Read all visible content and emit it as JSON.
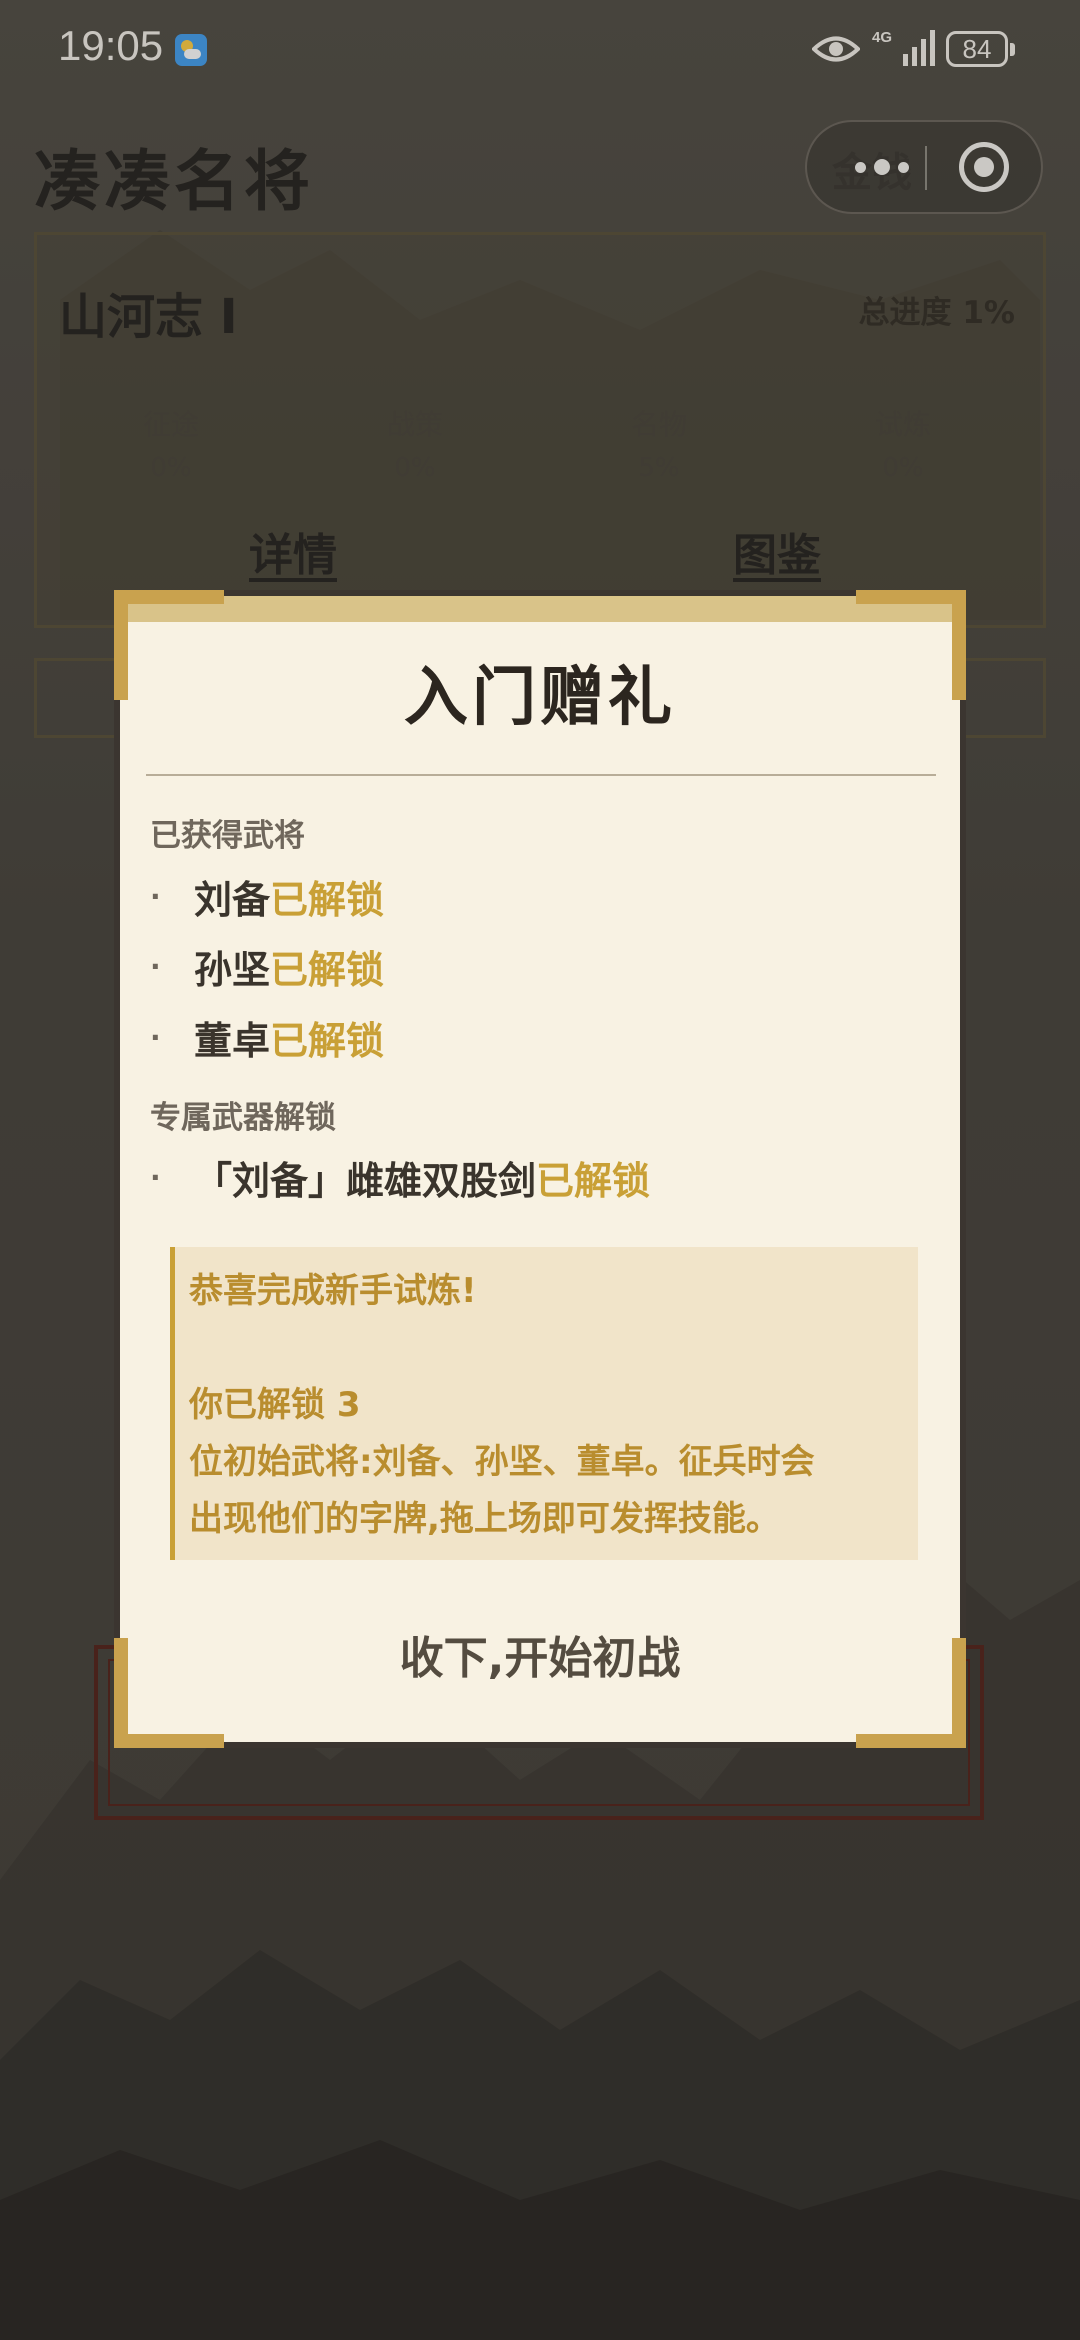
{
  "status_bar": {
    "time": "19:05",
    "network": "4G",
    "battery": "84"
  },
  "header": {
    "title": "凑凑名将",
    "currency_label": "金钱"
  },
  "progress_card": {
    "title": "山河志 I",
    "total_progress": "总进度 1%",
    "stats": [
      {
        "label": "征途",
        "value": "0%"
      },
      {
        "label": "战策",
        "value": "0%"
      },
      {
        "label": "名物",
        "value": "5%"
      },
      {
        "label": "试炼",
        "value": "0%"
      }
    ],
    "details_link": "详情",
    "codex_link": "图鉴"
  },
  "modal": {
    "title": "入门赠礼",
    "generals_section": "已获得武将",
    "generals": [
      {
        "name": "刘备",
        "status": "已解锁"
      },
      {
        "name": "孙坚",
        "status": "已解锁"
      },
      {
        "name": "董卓",
        "status": "已解锁"
      }
    ],
    "weapons_section": "专属武器解锁",
    "weapons": [
      {
        "name": "「刘备」雌雄双股剑",
        "status": "已解锁"
      }
    ],
    "notice": {
      "line1": "恭喜完成新手试炼!",
      "line2": "你已解锁 3",
      "line3": "位初始武将:刘备、孙坚、董卓。征兵时会",
      "line4": "出现他们的字牌,拖上场即可发挥技能。"
    },
    "confirm_label": "收下,开始初战"
  },
  "colors": {
    "accent_gold": "#c9a036",
    "modal_bg": "#f8f2e3",
    "notice_bg": "#f1e4c9"
  }
}
